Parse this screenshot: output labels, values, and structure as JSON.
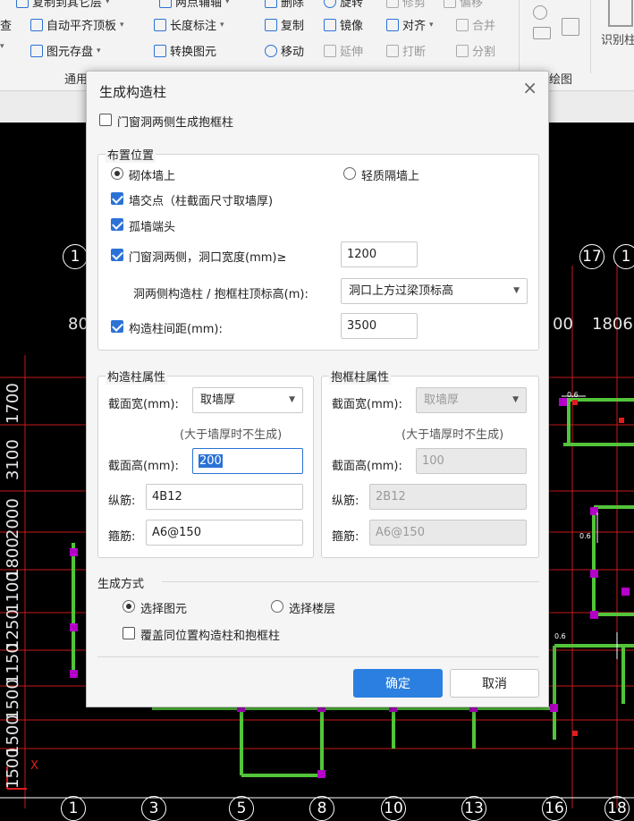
{
  "toolbar": {
    "row1": [
      {
        "label": "复制到其它层",
        "caret": true
      },
      {
        "label": "两点辅轴",
        "caret": true
      },
      {
        "label": "删除"
      },
      {
        "label": "旋转"
      },
      {
        "label": "修剪",
        "dim": true
      },
      {
        "label": "偏移",
        "dim": true
      }
    ],
    "row2": [
      {
        "label": "查"
      },
      {
        "label": "自动平齐顶板",
        "caret": true
      },
      {
        "label": "长度标注",
        "caret": true
      },
      {
        "label": "复制"
      },
      {
        "label": "镜像"
      },
      {
        "label": "对齐",
        "caret": true
      },
      {
        "label": "合并",
        "dim": true
      }
    ],
    "row3": [
      {
        "label": "图元存盘",
        "caret": true
      },
      {
        "label": "转换图元"
      },
      {
        "label": "移动"
      },
      {
        "label": "延伸",
        "dim": true
      },
      {
        "label": "打断",
        "dim": true
      },
      {
        "label": "分割",
        "dim": true
      }
    ],
    "right_label": "识别柱",
    "groups": {
      "general": "通用",
      "draw": "绘图"
    }
  },
  "canvas": {
    "axis_numbers_top": [
      "1",
      "17",
      "1"
    ],
    "dims_top": [
      "80",
      "00",
      "1806"
    ],
    "dims_left": [
      "1700",
      "3100",
      "2000",
      "1800",
      "1100",
      "1250",
      "1150",
      "1500",
      "1500",
      "1500"
    ],
    "axis_numbers_bottom": [
      "1",
      "3",
      "5",
      "8",
      "10",
      "13",
      "16",
      "18"
    ],
    "tag_small": "0.6",
    "origin_mark": "X"
  },
  "dialog": {
    "title": "生成构造柱",
    "close_glyph": "×",
    "opt_door_window_hug": {
      "label": "门窗洞两侧生成抱框柱",
      "checked": false
    },
    "placement": {
      "title": "布置位置",
      "radio_masonry": {
        "label": "砌体墙上",
        "checked": true
      },
      "radio_light": {
        "label": "轻质隔墙上",
        "checked": false
      },
      "cb_intersection": {
        "label": "墙交点（柱截面尺寸取墙厚)",
        "checked": true
      },
      "cb_isolated": {
        "label": "孤墙端头",
        "checked": true
      },
      "cb_opening": {
        "label": "门窗洞两侧，洞口宽度(mm)≥",
        "checked": true,
        "value": "1200"
      },
      "top_elev_label": "洞两侧构造柱 / 抱框柱顶标高(m):",
      "top_elev_value": "洞口上方过梁顶标高",
      "cb_spacing": {
        "label": "构造柱间距(mm):",
        "checked": true,
        "value": "3500"
      }
    },
    "column_props": {
      "title": "构造柱属性",
      "width_label": "截面宽(mm):",
      "width_value": "取墙厚",
      "note": "(大于墙厚时不生成)",
      "height_label": "截面高(mm):",
      "height_value": "200",
      "rebar_long_label": "纵筋:",
      "rebar_long_value": "4B12",
      "stirrup_label": "箍筋:",
      "stirrup_value": "A6@150"
    },
    "hug_props": {
      "title": "抱框柱属性",
      "width_label": "截面宽(mm):",
      "width_value": "取墙厚",
      "note": "(大于墙厚时不生成)",
      "height_label": "截面高(mm):",
      "height_value": "100",
      "rebar_long_label": "纵筋:",
      "rebar_long_value": "2B12",
      "stirrup_label": "箍筋:",
      "stirrup_value": "A6@150"
    },
    "generate": {
      "title": "生成方式",
      "radio_select_elem": {
        "label": "选择图元",
        "checked": true
      },
      "radio_select_floor": {
        "label": "选择楼层",
        "checked": false
      },
      "cb_overwrite": {
        "label": "覆盖同位置构造柱和抱框柱",
        "checked": false
      }
    },
    "ok_label": "确定",
    "cancel_label": "取消"
  },
  "colors": {
    "accent": "#2b7fe0",
    "cad_green": "#53c43a",
    "cad_magenta": "#b400c8",
    "cad_red": "#e11c1c"
  }
}
